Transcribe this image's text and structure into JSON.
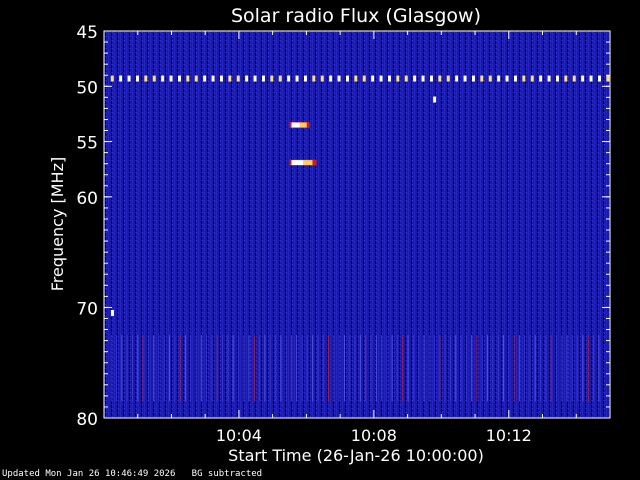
{
  "chart_data": {
    "type": "heatmap",
    "title": "Solar radio Flux (Glasgow)",
    "xlabel": "Start Time (26-Jan-26 10:00:00)",
    "ylabel": "Frequency [MHz]",
    "x_unit": "minutes after 10:00:00",
    "xlim": [
      0,
      15
    ],
    "ylim": [
      45,
      80
    ],
    "y_reversed": true,
    "x_ticks": [
      {
        "value": 4,
        "label": "10:04"
      },
      {
        "value": 8,
        "label": "10:08"
      },
      {
        "value": 12,
        "label": "10:12"
      }
    ],
    "y_ticks": [
      {
        "value": 45,
        "label": "45"
      },
      {
        "value": 50,
        "label": "50"
      },
      {
        "value": 55,
        "label": "55"
      },
      {
        "value": 60,
        "label": "60"
      },
      {
        "value": 70,
        "label": "70"
      },
      {
        "value": 80,
        "label": "80"
      }
    ],
    "background_color": "#1c1ca6",
    "features": [
      {
        "kind": "interference-line",
        "frequency_mhz": 49.3,
        "x_start": 0.2,
        "x_end": 14.9
      },
      {
        "kind": "burst",
        "frequency_mhz": 53.5,
        "x_start": 5.5,
        "x_end": 6.1
      },
      {
        "kind": "burst",
        "frequency_mhz": 56.9,
        "x_start": 5.5,
        "x_end": 6.3
      },
      {
        "kind": "spot",
        "frequency_mhz": 51.2,
        "x": 9.8
      },
      {
        "kind": "spot",
        "frequency_mhz": 70.5,
        "x": 0.25
      },
      {
        "kind": "noise-band",
        "freq_start": 72.5,
        "freq_end": 78.5,
        "x_start": 0.2,
        "x_end": 14.8
      }
    ]
  },
  "footer": {
    "updated": "Updated Mon Jan 26 10:46:49 2026",
    "note": "BG subtracted"
  }
}
